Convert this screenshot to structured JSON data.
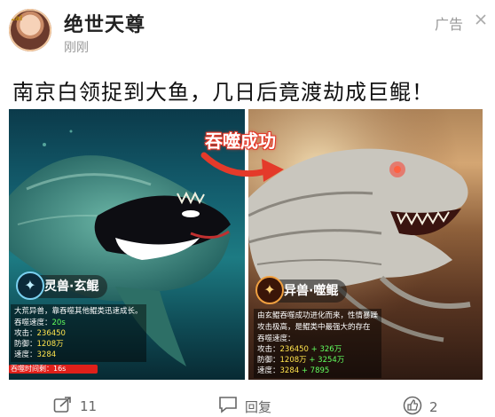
{
  "post": {
    "author": "绝世天尊",
    "time": "刚刚",
    "ad_label": "广告",
    "close_glyph": "✕",
    "avatar_tag": "Lai",
    "headline": "南京白领捉到大鱼，几日后竟渡劫成巨鲲！"
  },
  "image": {
    "arrow_text": "吞噬成功",
    "left": {
      "badge": "灵兽·玄鲲",
      "desc": "大荒异兽，靠吞噬其他鲲类迅速成长。",
      "rows": [
        {
          "label": "吞噬速度：",
          "value": "20s",
          "plus": ""
        },
        {
          "label": "攻击：",
          "value": "236450",
          "plus": ""
        },
        {
          "label": "防御：",
          "value": "1208万",
          "plus": ""
        },
        {
          "label": "速度：",
          "value": "3284",
          "plus": ""
        }
      ],
      "timer": "吞噬时间剩：16s"
    },
    "right": {
      "badge": "异兽·噬鲲",
      "desc1": "由玄鲲吞噬成功进化而来，性情暴躁",
      "desc2": "攻击极高，是鲲类中最强大的存在",
      "rows": [
        {
          "label": "吞噬速度：",
          "value": "",
          "plus": ""
        },
        {
          "label": "攻击：",
          "value": "236450",
          "plus": "+ 326万"
        },
        {
          "label": "防御：",
          "value": "1208万",
          "plus": "+ 3254万"
        },
        {
          "label": "速度：",
          "value": "3284",
          "plus": "+ 7895"
        }
      ]
    }
  },
  "actions": {
    "share_count": "11",
    "comment_label": "回复",
    "like_count": "2"
  },
  "colors": {
    "accent_red": "#e43a2a",
    "stat_yellow": "#ffe44d",
    "stat_green": "#62ff5e"
  }
}
